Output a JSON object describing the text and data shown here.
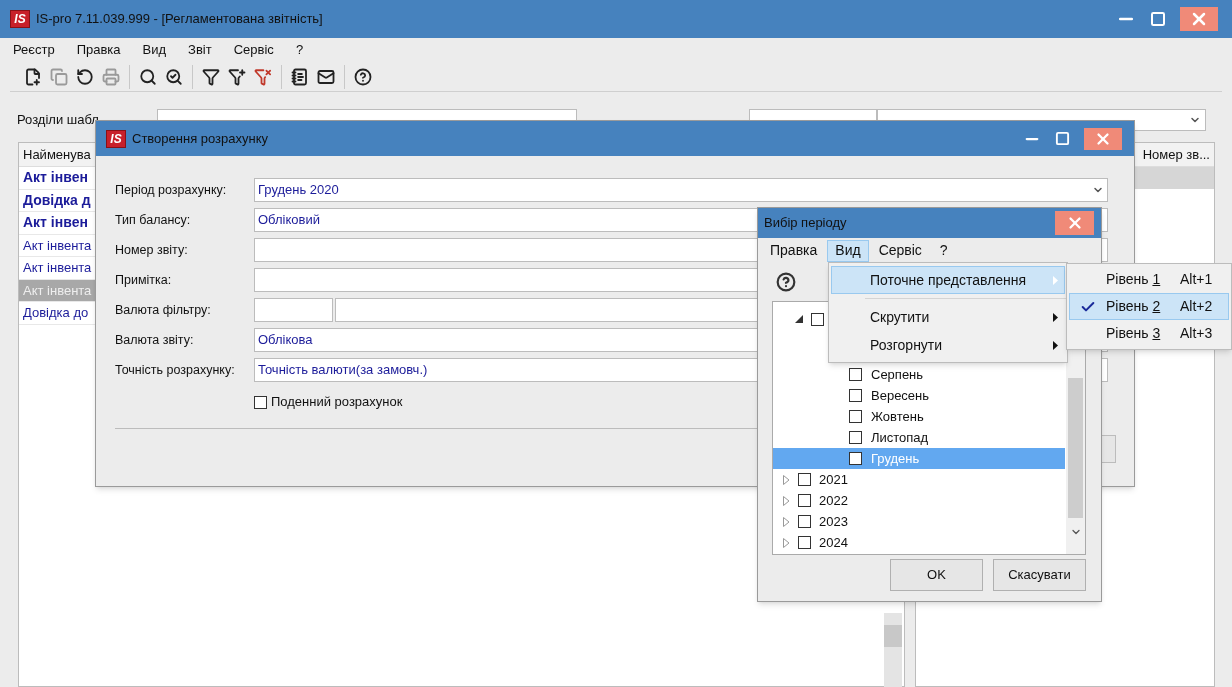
{
  "window": {
    "logo": "IS",
    "title": "IS-pro 7.11.039.999 - [Регламентована звітність]"
  },
  "menu": [
    "Реєстр",
    "Правка",
    "Вид",
    "Звіт",
    "Сервіс",
    "?"
  ],
  "toolbar": [
    {
      "kind": "new",
      "disabled": false
    },
    {
      "kind": "copy",
      "disabled": true
    },
    {
      "kind": "refresh",
      "disabled": false
    },
    {
      "kind": "print",
      "disabled": true
    },
    {
      "kind": "separator"
    },
    {
      "kind": "find",
      "disabled": false
    },
    {
      "kind": "find-next",
      "disabled": false
    },
    {
      "kind": "separator"
    },
    {
      "kind": "filter",
      "disabled": false
    },
    {
      "kind": "filter-add",
      "disabled": false
    },
    {
      "kind": "filter-clear",
      "disabled": false
    },
    {
      "kind": "separator"
    },
    {
      "kind": "form",
      "disabled": false
    },
    {
      "kind": "mail",
      "disabled": false
    },
    {
      "kind": "separator"
    },
    {
      "kind": "help",
      "disabled": false
    }
  ],
  "sections_label": "Розділи шабл",
  "list": {
    "header": "Найменува",
    "rows": [
      {
        "text": "Акт інвен",
        "bold": true,
        "selected": false
      },
      {
        "text": "Довідка д",
        "bold": true,
        "selected": false
      },
      {
        "text": "Акт інвен",
        "bold": true,
        "selected": false
      },
      {
        "text": "Акт інвента",
        "bold": false,
        "selected": false
      },
      {
        "text": "Акт інвента",
        "bold": false,
        "selected": false
      },
      {
        "text": "Акт інвента",
        "bold": false,
        "selected": true
      },
      {
        "text": "Довідка до",
        "bold": false,
        "selected": false
      }
    ]
  },
  "right_panel": {
    "header": "Номер зв...",
    "rows": [
      {
        "selected": true
      }
    ]
  },
  "dialog": {
    "logo": "IS",
    "title": "Створення розрахунку",
    "fields": [
      {
        "label": "Період розрахунку:",
        "value": "Грудень 2020",
        "kind": "combo"
      },
      {
        "label": "Тип балансу:",
        "value": "Обліковий",
        "kind": "text"
      },
      {
        "label": "Номер звіту:",
        "kind": "text"
      },
      {
        "label": "Примітка:",
        "kind": "text"
      },
      {
        "label": "Валюта фільтру:",
        "kind": "split"
      },
      {
        "label": "Валюта звіту:",
        "value": "Облікова",
        "kind": "text"
      },
      {
        "label": "Точність розрахунку:",
        "value": "Точність валюти(за замовч.)",
        "kind": "text"
      }
    ],
    "daily": {
      "label": "Поденний розрахунок",
      "checked": false
    }
  },
  "period_dialog": {
    "title": "Вибір періоду",
    "menu": [
      {
        "label": "Правка",
        "selected": false
      },
      {
        "label": "Вид",
        "selected": true
      },
      {
        "label": "Сервіс",
        "selected": false
      },
      {
        "label": "?",
        "selected": false
      }
    ],
    "tree": [
      {
        "expanded": true,
        "checked": false,
        "children": [
          {
            "label": "Серпень",
            "checked": false,
            "selected": false
          },
          {
            "label": "Вересень",
            "checked": false,
            "selected": false
          },
          {
            "label": "Жовтень",
            "checked": false,
            "selected": false
          },
          {
            "label": "Листопад",
            "checked": false,
            "selected": false
          },
          {
            "label": "Грудень",
            "checked": false,
            "selected": true
          }
        ]
      },
      {
        "label": "2021",
        "expanded": false,
        "checked": false,
        "selected": false
      },
      {
        "label": "2022",
        "expanded": false,
        "checked": false,
        "selected": false
      },
      {
        "label": "2023",
        "expanded": false,
        "checked": false,
        "selected": false
      },
      {
        "label": "2024",
        "expanded": false,
        "checked": false,
        "selected": false
      }
    ],
    "buttons": [
      "OK",
      "Скасувати"
    ]
  },
  "view_menu": [
    {
      "kind": "item",
      "label": "Поточне представлення",
      "selected": true
    },
    {
      "kind": "separator"
    },
    {
      "kind": "item",
      "label": "Скрутити",
      "selected": false
    },
    {
      "kind": "item",
      "label": "Розгорнути",
      "selected": false
    }
  ],
  "levels_menu": [
    {
      "label": "Рівень",
      "mnemonic": "1",
      "shortcut": "Alt+1",
      "checked": false,
      "selected": false
    },
    {
      "label": "Рівень",
      "mnemonic": "2",
      "shortcut": "Alt+2",
      "checked": true,
      "selected": true
    },
    {
      "label": "Рівень",
      "mnemonic": "3",
      "shortcut": "Alt+3",
      "checked": false,
      "selected": false
    }
  ]
}
